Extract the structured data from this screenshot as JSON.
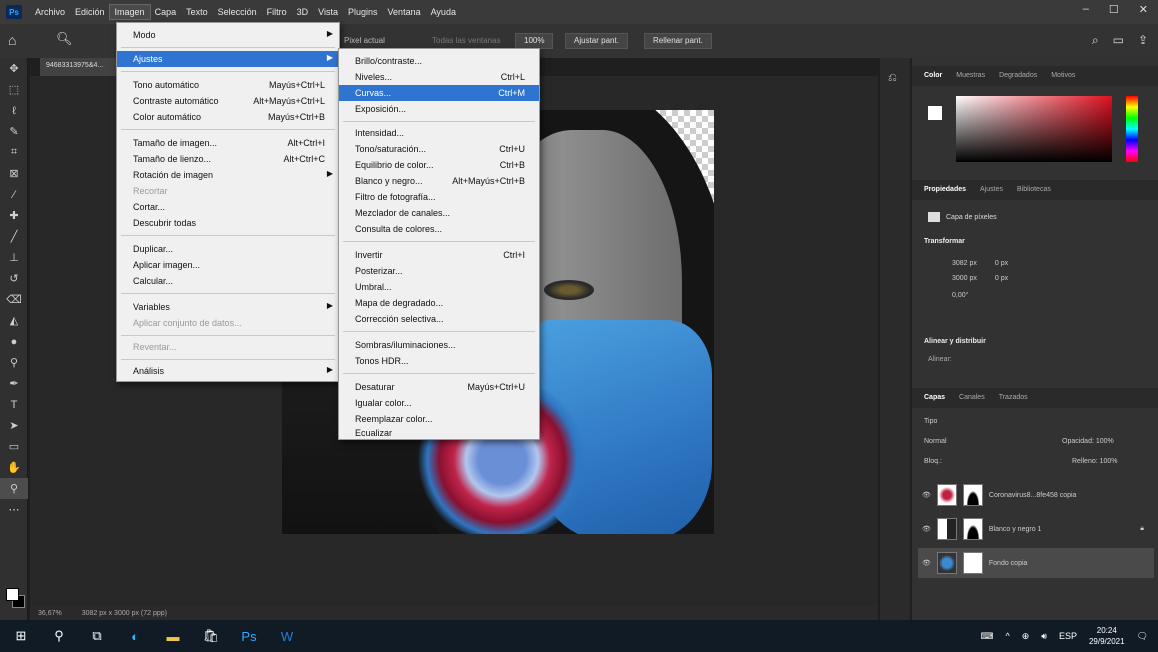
{
  "menubar": {
    "logo": "Ps",
    "items": [
      "Archivo",
      "Edición",
      "Imagen",
      "Capa",
      "Texto",
      "Selección",
      "Filtro",
      "3D",
      "Vista",
      "Plugins",
      "Ventana",
      "Ayuda"
    ],
    "window_controls": [
      "–",
      "☐",
      "✕"
    ]
  },
  "options_bar": {
    "field1": "Pixel actual",
    "field2": "Todas las ventanas",
    "zoom_btn": "100%",
    "fit_btn": "Ajustar pant.",
    "fill_btn": "Rellenar pant."
  },
  "document": {
    "tab_title": "94683313975&4...",
    "zoom": "36,67%",
    "doc_info": "3082 px x 3000 px (72 ppp)"
  },
  "imagen_menu": {
    "items": [
      {
        "label": "Modo",
        "shortcut": "",
        "submenu": true,
        "disabled": false
      },
      {
        "label": "Ajustes",
        "shortcut": "",
        "submenu": true,
        "disabled": false,
        "highlight": true
      },
      {
        "label": "Tono automático",
        "shortcut": "Mayús+Ctrl+L"
      },
      {
        "label": "Contraste automático",
        "shortcut": "Alt+Mayús+Ctrl+L"
      },
      {
        "label": "Color automático",
        "shortcut": "Mayús+Ctrl+B"
      },
      {
        "label": "Tamaño de imagen...",
        "shortcut": "Alt+Ctrl+I"
      },
      {
        "label": "Tamaño de lienzo...",
        "shortcut": "Alt+Ctrl+C"
      },
      {
        "label": "Rotación de imagen",
        "shortcut": "",
        "submenu": true
      },
      {
        "label": "Recortar",
        "shortcut": "",
        "disabled": true
      },
      {
        "label": "Cortar...",
        "shortcut": ""
      },
      {
        "label": "Descubrir todas",
        "shortcut": ""
      },
      {
        "label": "Duplicar...",
        "shortcut": ""
      },
      {
        "label": "Aplicar imagen...",
        "shortcut": ""
      },
      {
        "label": "Calcular...",
        "shortcut": ""
      },
      {
        "label": "Variables",
        "shortcut": "",
        "submenu": true
      },
      {
        "label": "Aplicar conjunto de datos...",
        "shortcut": "",
        "disabled": true
      },
      {
        "label": "Reventar...",
        "shortcut": "",
        "disabled": true
      },
      {
        "label": "Análisis",
        "shortcut": "",
        "submenu": true
      }
    ]
  },
  "ajustes_menu": {
    "items": [
      {
        "label": "Brillo/contraste...",
        "shortcut": ""
      },
      {
        "label": "Niveles...",
        "shortcut": "Ctrl+L"
      },
      {
        "label": "Curvas...",
        "shortcut": "Ctrl+M",
        "highlight": true
      },
      {
        "label": "Exposición...",
        "shortcut": ""
      },
      {
        "label": "Intensidad...",
        "shortcut": ""
      },
      {
        "label": "Tono/saturación...",
        "shortcut": "Ctrl+U"
      },
      {
        "label": "Equilibrio de color...",
        "shortcut": "Ctrl+B"
      },
      {
        "label": "Blanco y negro...",
        "shortcut": "Alt+Mayús+Ctrl+B"
      },
      {
        "label": "Filtro de fotografía...",
        "shortcut": ""
      },
      {
        "label": "Mezclador de canales...",
        "shortcut": ""
      },
      {
        "label": "Consulta de colores...",
        "shortcut": ""
      },
      {
        "label": "Invertir",
        "shortcut": "Ctrl+I"
      },
      {
        "label": "Posterizar...",
        "shortcut": ""
      },
      {
        "label": "Umbral...",
        "shortcut": ""
      },
      {
        "label": "Mapa de degradado...",
        "shortcut": ""
      },
      {
        "label": "Corrección selectiva...",
        "shortcut": ""
      },
      {
        "label": "Sombras/iluminaciones...",
        "shortcut": ""
      },
      {
        "label": "Tonos HDR...",
        "shortcut": ""
      },
      {
        "label": "Desaturar",
        "shortcut": "Mayús+Ctrl+U"
      },
      {
        "label": "Igualar color...",
        "shortcut": ""
      },
      {
        "label": "Reemplazar color...",
        "shortcut": ""
      },
      {
        "label": "Ecualizar",
        "shortcut": ""
      }
    ]
  },
  "color_panel": {
    "tabs": [
      "Color",
      "Muestras",
      "Degradados",
      "Motivos"
    ]
  },
  "properties_panel": {
    "tabs": [
      "Propiedades",
      "Ajustes",
      "Bibliotecas"
    ],
    "layer_type": "Capa de píxeles",
    "transform_title": "Transformar",
    "width": "3082 px",
    "height": "3000 px",
    "x": "0 px",
    "y": "0 px",
    "angle": "0,00°",
    "align_title": "Alinear y distribuir",
    "align_label": "Alinear:"
  },
  "layers_panel": {
    "tabs": [
      "Capas",
      "Canales",
      "Trazados"
    ],
    "filter": "Tipo",
    "blend_mode": "Normal",
    "opacity": "Opacidad: 100%",
    "lock_label": "Bloq.:",
    "fill": "Relleno: 100%",
    "layers": [
      {
        "name": "Coronavirus8...8fe458 copia"
      },
      {
        "name": "Blanco y negro 1"
      },
      {
        "name": "Fondo copia",
        "selected": true
      }
    ]
  },
  "taskbar": {
    "lang": "ESP",
    "time": "20:24",
    "date": "29/9/2021"
  },
  "colors": {
    "accent": "#3074d1",
    "panel_bg": "#323232",
    "menu_bg": "#f0f0f0"
  }
}
